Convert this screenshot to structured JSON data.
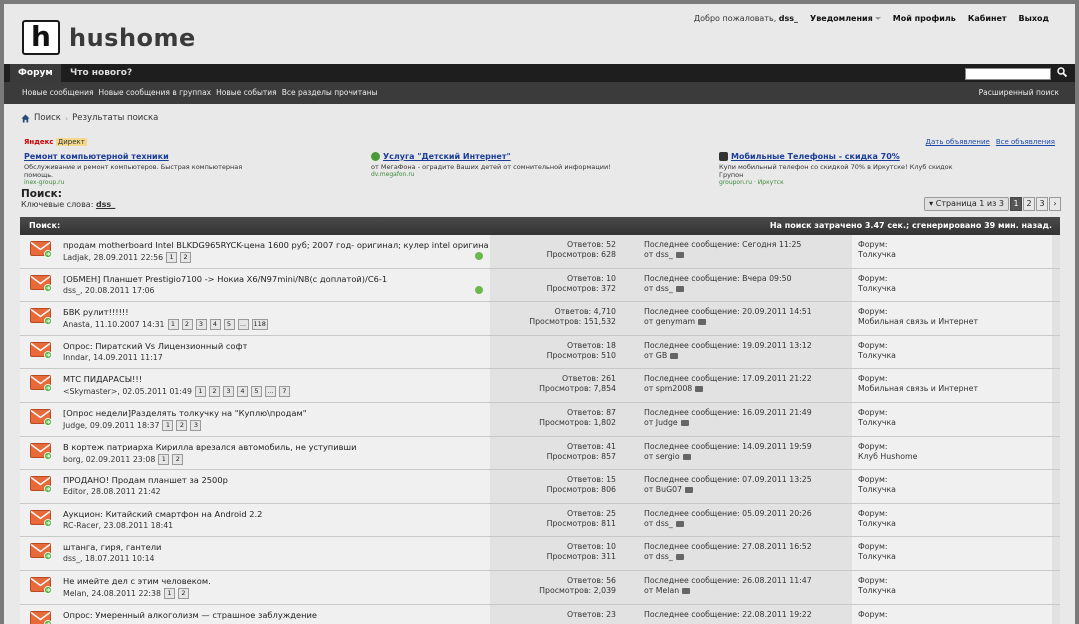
{
  "site": {
    "logo_letter": "h",
    "name": "hushome"
  },
  "user_nav": {
    "welcome": "Добро пожаловать,",
    "username": "dss_",
    "notifications": "Уведомления",
    "profile": "Мой профиль",
    "cabinet": "Кабинет",
    "logout": "Выход"
  },
  "nav": {
    "forum": "Форум",
    "whats_new": "Что нового?"
  },
  "subnav": {
    "new_posts": "Новые сообщения",
    "new_group_posts": "Новые сообщения в группах",
    "new_events": "Новые события",
    "all_read": "Все разделы прочитаны",
    "advanced_search": "Расширенный поиск"
  },
  "breadcrumb": {
    "search": "Поиск",
    "results": "Результаты поиска"
  },
  "ads": {
    "yandex": "Яндекс",
    "direct": "Директ",
    "give_ad": "Дать объявление",
    "all_ads": "Все объявления",
    "items": [
      {
        "title": "Ремонт компьютерной техники",
        "desc": "Обслуживание и ремонт компьютеров. Быстрая компьютерная помощь.",
        "url": "inex-group.ru"
      },
      {
        "title": "Услуга \"Детский Интернет\"",
        "desc": "от МегаФона - оградите Ваших детей от сомнительной информации!",
        "url": "dv.megafon.ru"
      },
      {
        "title": "Мобильные Телефоны - скидка 70%",
        "desc": "Купи мобильный телефон со скидкой 70% в Иркутске! Клуб скидок Групон",
        "url": "groupon.ru · Иркутск"
      }
    ]
  },
  "search": {
    "heading": "Поиск:",
    "keywords_label": "Ключевые слова:",
    "keywords": "dss_"
  },
  "pager": {
    "label": "Страница 1 из 3",
    "pages": [
      "1",
      "2",
      "3"
    ],
    "next": "›"
  },
  "results": {
    "head_left": "Поиск:",
    "head_right": "На поиск затрачено 3.47 сек.; сгенерировано 39 мин. назад.",
    "replies_label": "Ответов:",
    "views_label": "Просмотров:",
    "last_label": "Последнее сообщение:",
    "from_label": "от",
    "forum_label": "Форум:",
    "rows": [
      {
        "title": "продам motherboard Intel BLKDG965RYCK-цена 1600 руб; 2007 год- оригинал; кулер intel оригинал, без",
        "meta": "Ladjak, 28.09.2011 22:56",
        "pages": [
          "1",
          "2"
        ],
        "replies": "52",
        "views": "628",
        "last_date": "Сегодня 11:25",
        "last_user": "dss_",
        "forum": "Толкучка",
        "sticky": true
      },
      {
        "title": "[ОБМЕН] Планшет Prestigio7100 -> Нокиа X6/N97mini/N8(с доплатой)/C6-1",
        "meta": "dss_, 20.08.2011 17:06",
        "pages": [],
        "replies": "10",
        "views": "372",
        "last_date": "Вчера 09:50",
        "last_user": "dss_",
        "forum": "Толкучка",
        "sticky": true
      },
      {
        "title": "БВК рулит!!!!!!",
        "meta": "Anasta, 11.10.2007 14:31",
        "pages": [
          "1",
          "2",
          "3",
          "4",
          "5",
          "...",
          "118"
        ],
        "replies": "4,710",
        "views": "151,532",
        "last_date": "20.09.2011 14:51",
        "last_user": "genymam",
        "forum": "Мобильная связь и Интернет",
        "sticky": false
      },
      {
        "title": "Опрос: Пиратский Vs Лицензионный софт",
        "meta": "Inndar, 14.09.2011 11:17",
        "pages": [],
        "replies": "18",
        "views": "510",
        "last_date": "19.09.2011 13:12",
        "last_user": "GB",
        "forum": "Толкучка",
        "sticky": false
      },
      {
        "title": "МТС ПИДАРАСЫ!!!",
        "meta": "<Skymaster>, 02.05.2011 01:49",
        "pages": [
          "1",
          "2",
          "3",
          "4",
          "5",
          "...",
          "7"
        ],
        "replies": "261",
        "views": "7,854",
        "last_date": "17.09.2011 21:22",
        "last_user": "spm2008",
        "forum": "Мобильная связь и Интернет",
        "sticky": false
      },
      {
        "title": "[Опрос недели]Разделять толкучку на \"Куплю\\продам\"",
        "meta": "Judge, 09.09.2011 18:37",
        "pages": [
          "1",
          "2",
          "3"
        ],
        "replies": "87",
        "views": "1,802",
        "last_date": "16.09.2011 21:49",
        "last_user": "Judge",
        "forum": "Толкучка",
        "sticky": false
      },
      {
        "title": "В кортеж патриарха Кирилла врезался автомобиль, не уступивши",
        "meta": "borg, 02.09.2011 23:08",
        "pages": [
          "1",
          "2"
        ],
        "replies": "41",
        "views": "857",
        "last_date": "14.09.2011 19:59",
        "last_user": "sergio",
        "forum": "Клуб Hushome",
        "sticky": false
      },
      {
        "title": "ПРОДАНО! Продам планшет за 2500р",
        "meta": "Editor, 28.08.2011 21:42",
        "pages": [],
        "replies": "15",
        "views": "806",
        "last_date": "07.09.2011 13:25",
        "last_user": "BuG07",
        "forum": "Толкучка",
        "sticky": false
      },
      {
        "title": "Аукцион: Китайский смартфон на Android 2.2",
        "meta": "RC-Racer, 23.08.2011 18:41",
        "pages": [],
        "replies": "25",
        "views": "811",
        "last_date": "05.09.2011 20:26",
        "last_user": "dss_",
        "forum": "Толкучка",
        "sticky": false
      },
      {
        "title": "штанга, гиря, гантели",
        "meta": "dss_, 18.07.2011 10:14",
        "pages": [],
        "replies": "10",
        "views": "311",
        "last_date": "27.08.2011 16:52",
        "last_user": "dss_",
        "forum": "Толкучка",
        "sticky": false
      },
      {
        "title": "Не имейте дел с этим человеком.",
        "meta": "Melan, 24.08.2011 22:38",
        "pages": [
          "1",
          "2"
        ],
        "replies": "56",
        "views": "2,039",
        "last_date": "26.08.2011 11:47",
        "last_user": "Melan",
        "forum": "Толкучка",
        "sticky": false
      },
      {
        "title": "Опрос: Умеренный алкоголизм — страшное заблуждение",
        "meta": "",
        "pages": [],
        "replies": "23",
        "views": "",
        "last_date": "22.08.2011 19:22",
        "last_user": "",
        "forum": "",
        "sticky": false
      }
    ]
  }
}
